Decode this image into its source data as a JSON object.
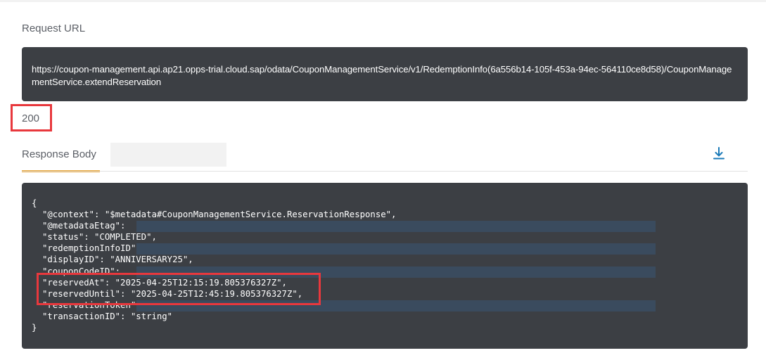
{
  "request_url_section": {
    "label": "Request URL",
    "url": "https://coupon-management.api.ap21.opps-trial.cloud.sap/odata/CouponManagementService/v1/RedemptionInfo(6a556b14-105f-453a-94ec-564110ce8d58)/CouponManagementService.extendReservation"
  },
  "status_code": "200",
  "tabs": {
    "response_body_label": "Response Body"
  },
  "icons": {
    "download": "download-icon"
  },
  "response_body": {
    "open_brace": "{",
    "close_brace": "}",
    "lines": [
      "\"@context\": \"$metadata#CouponManagementService.ReservationResponse\",",
      "\"@metadataEtag\":",
      "\"status\": \"COMPLETED\",",
      "\"redemptionInfoID\":",
      "\"displayID\": \"ANNIVERSARY25\",",
      "\"couponCodeID\":",
      "\"reservedAt\": \"2025-04-25T12:15:19.805376327Z\",",
      "\"reservedUntil\": \"2025-04-25T12:45:19.805376327Z\",",
      "\"reservationToken\":",
      "\"transactionID\": \"string\""
    ]
  },
  "colors": {
    "code_background": "#3c3f44",
    "highlight": "#e8383d",
    "tab_underline": "#e9a431",
    "redaction": "#3a4b5e",
    "icon_accent": "#1a7ab8"
  }
}
